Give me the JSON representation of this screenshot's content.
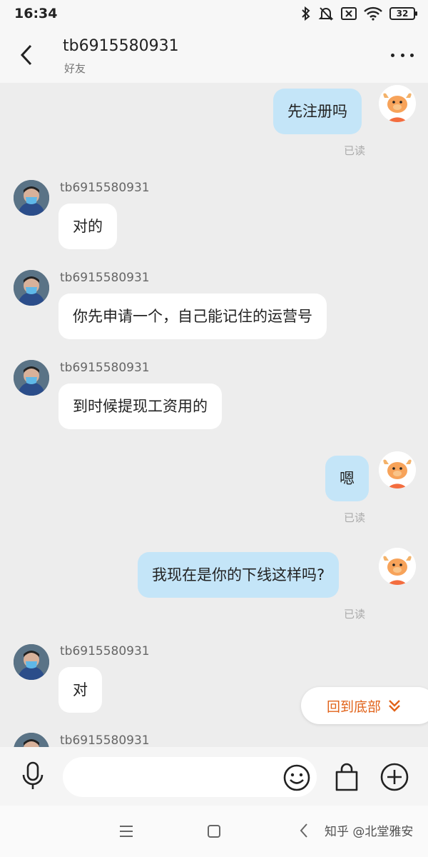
{
  "status_bar": {
    "time": "16:34",
    "battery": "32"
  },
  "header": {
    "title": "tb6915580931",
    "subtitle": "好友"
  },
  "messages": [
    {
      "from": "me",
      "text": "先注册吗",
      "status": "已读"
    },
    {
      "from": "other",
      "sender": "tb6915580931",
      "text": "对的"
    },
    {
      "from": "other",
      "sender": "tb6915580931",
      "text": "你先申请一个，自己能记住的运营号"
    },
    {
      "from": "other",
      "sender": "tb6915580931",
      "text": "到时候提现工资用的"
    },
    {
      "from": "me",
      "text": "嗯",
      "status": "已读"
    },
    {
      "from": "me",
      "text": "我现在是你的下线这样吗?",
      "status": "已读"
    },
    {
      "from": "other",
      "sender": "tb6915580931",
      "text": "对"
    },
    {
      "from": "other",
      "sender": "tb6915580931",
      "text": ""
    }
  ],
  "back_to_bottom": "回到底部",
  "input": {
    "value": "",
    "placeholder": ""
  },
  "watermark": "知乎 @北堂雅安",
  "colors": {
    "my_bubble": "#c4e5f8",
    "other_bubble": "#ffffff",
    "accent": "#e1631a",
    "background": "#ededed"
  }
}
